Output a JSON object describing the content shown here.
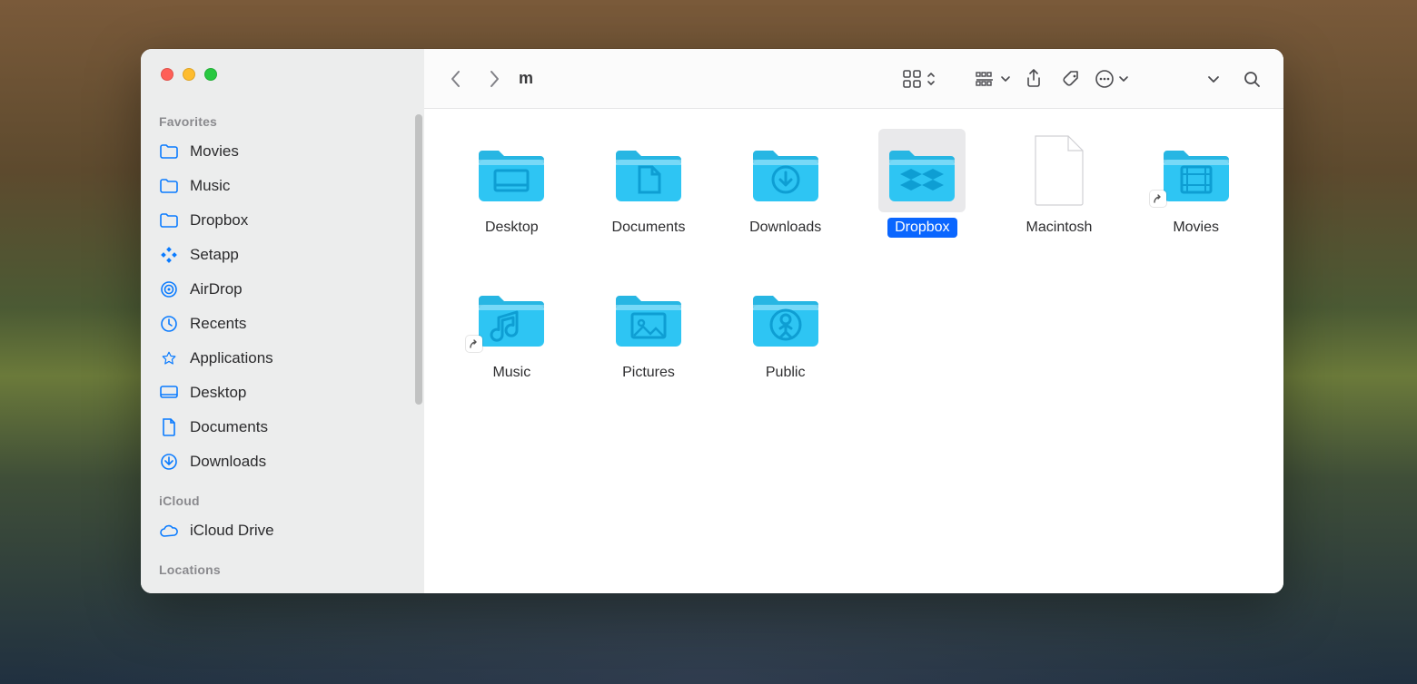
{
  "window": {
    "title": "m"
  },
  "sidebar": {
    "sections": [
      {
        "title": "Favorites",
        "items": [
          {
            "label": "Movies",
            "icon": "folder"
          },
          {
            "label": "Music",
            "icon": "folder"
          },
          {
            "label": "Dropbox",
            "icon": "folder"
          },
          {
            "label": "Setapp",
            "icon": "setapp"
          },
          {
            "label": "AirDrop",
            "icon": "airdrop"
          },
          {
            "label": "Recents",
            "icon": "clock"
          },
          {
            "label": "Applications",
            "icon": "apps"
          },
          {
            "label": "Desktop",
            "icon": "desktop"
          },
          {
            "label": "Documents",
            "icon": "document"
          },
          {
            "label": "Downloads",
            "icon": "download"
          }
        ]
      },
      {
        "title": "iCloud",
        "items": [
          {
            "label": "iCloud Drive",
            "icon": "cloud"
          }
        ]
      },
      {
        "title": "Locations",
        "items": []
      }
    ]
  },
  "items": [
    {
      "label": "Desktop",
      "kind": "folder",
      "glyph": "desktop",
      "selected": false,
      "alias": false
    },
    {
      "label": "Documents",
      "kind": "folder",
      "glyph": "document",
      "selected": false,
      "alias": false
    },
    {
      "label": "Downloads",
      "kind": "folder",
      "glyph": "download",
      "selected": false,
      "alias": false
    },
    {
      "label": "Dropbox",
      "kind": "folder",
      "glyph": "dropbox",
      "selected": true,
      "alias": false
    },
    {
      "label": "Macintosh",
      "kind": "file",
      "glyph": "blank",
      "selected": false,
      "alias": false
    },
    {
      "label": "Movies",
      "kind": "folder",
      "glyph": "movies",
      "selected": false,
      "alias": true
    },
    {
      "label": "Music",
      "kind": "folder",
      "glyph": "music",
      "selected": false,
      "alias": true
    },
    {
      "label": "Pictures",
      "kind": "folder",
      "glyph": "pictures",
      "selected": false,
      "alias": false
    },
    {
      "label": "Public",
      "kind": "folder",
      "glyph": "public",
      "selected": false,
      "alias": false
    }
  ],
  "colors": {
    "folder": "#2ec5f3",
    "folder_tab": "#27b6e3",
    "folder_glyph": "#0e9ed3",
    "selection": "#0a66ff",
    "sidebar_accent": "#0a7bff"
  }
}
